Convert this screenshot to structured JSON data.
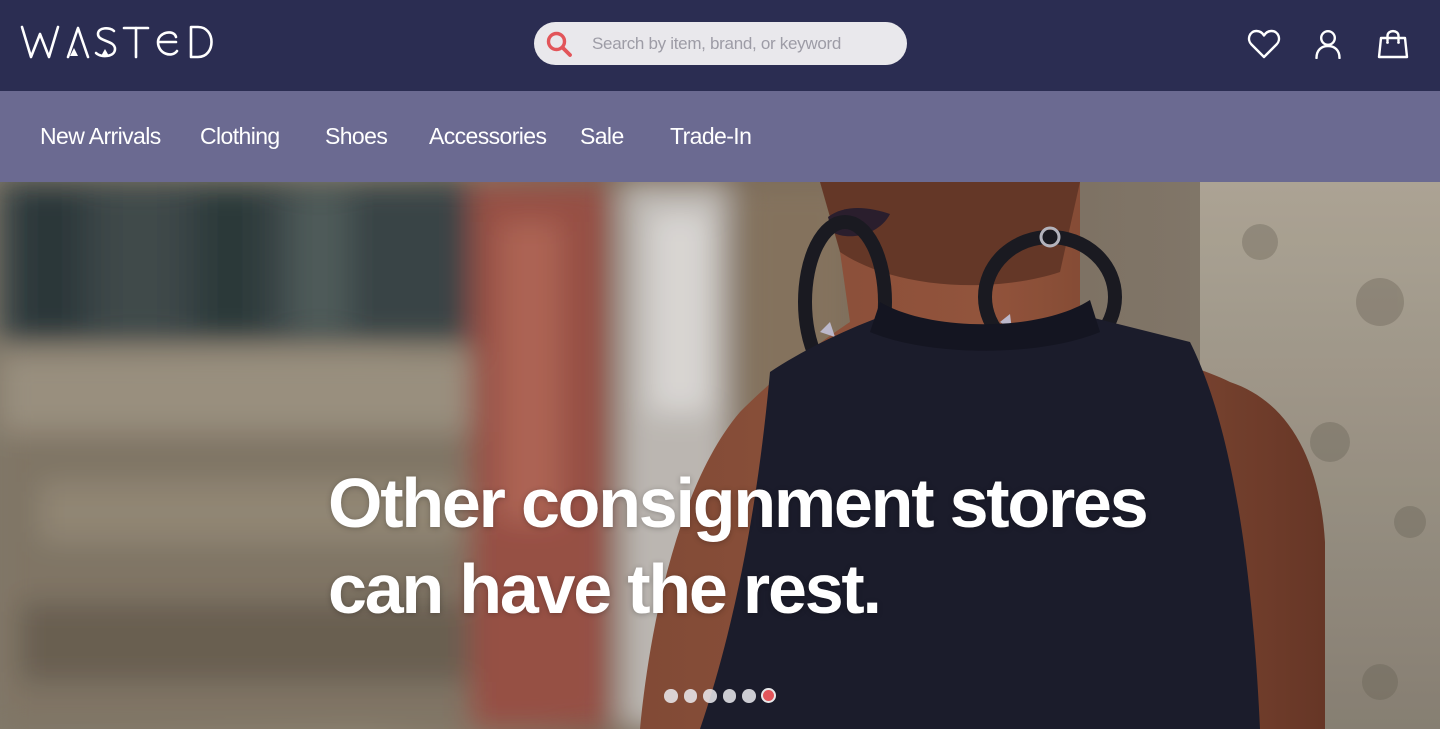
{
  "brand": {
    "logo_text": "WASTED"
  },
  "search": {
    "placeholder": "Search by item, brand, or keyword",
    "icon": "search-icon",
    "icon_color": "#e2555a"
  },
  "header_icons": [
    {
      "icon": "heart-icon",
      "label": "Wishlist"
    },
    {
      "icon": "user-icon",
      "label": "Account"
    },
    {
      "icon": "shopping-bag-icon",
      "label": "Cart"
    }
  ],
  "nav": {
    "items": [
      {
        "label": "New Arrivals"
      },
      {
        "label": "Clothing"
      },
      {
        "label": "Shoes"
      },
      {
        "label": "Accessories"
      },
      {
        "label": "Sale"
      },
      {
        "label": "Trade-In"
      }
    ]
  },
  "hero": {
    "headline_line1": "Other consignment stores",
    "headline_line2": "can have the rest.",
    "slide_count": 6,
    "active_slide": 6
  },
  "colors": {
    "header_bg": "#2b2d52",
    "nav_bg": "#6b6a91",
    "accent": "#e2555a",
    "text_light": "#ffffff"
  }
}
